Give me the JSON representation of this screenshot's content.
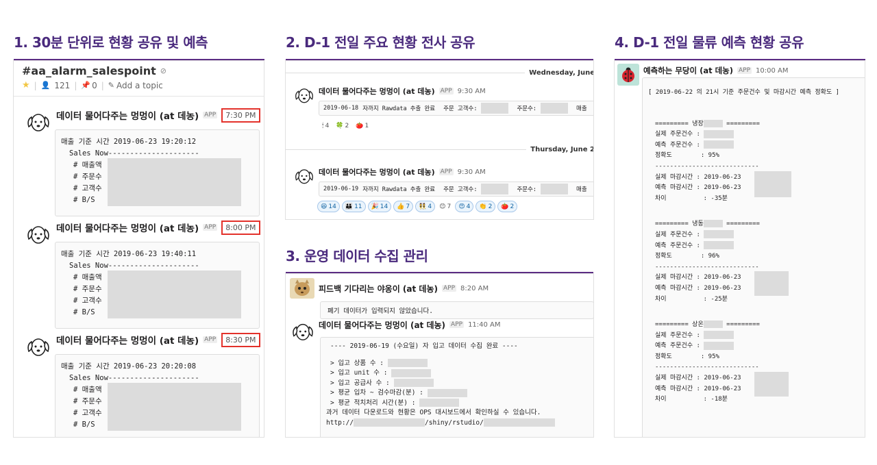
{
  "sections": [
    {
      "title": "1. 30분 단위로 현황 공유 및 예측"
    },
    {
      "title": "2. D-1 전일 주요 현황 전사 공유"
    },
    {
      "title": "3. 운영 데이터 수집 관리"
    },
    {
      "title": "4. D-1 전일 물류 예측 현황 공유"
    }
  ],
  "panel1": {
    "channel": "#aa_alarm_salespoint",
    "members": "121",
    "pins": "0",
    "add_topic": "Add a topic",
    "sender": "데이터 물어다주는 멍멍이 (at 데농)",
    "app": "APP",
    "messages": [
      {
        "time": "7:30 PM",
        "header": "매출 기준 시간 2019-06-23 19:20:12",
        "sales_now": "Sales Now---------------------",
        "rows": [
          "# 매출액",
          "# 주문수",
          "# 고객수",
          "# B/S"
        ]
      },
      {
        "time": "8:00 PM",
        "header": "매출 기준 시간 2019-06-23 19:40:11",
        "sales_now": "Sales Now---------------------",
        "rows": [
          "# 매출액",
          "# 주문수",
          "# 고객수",
          "# B/S"
        ]
      },
      {
        "time": "8:30 PM",
        "header": "매출 기준 시간 2019-06-23 20:20:08",
        "sales_now": "Sales Now---------------------",
        "rows": [
          "# 매출액",
          "# 주문수",
          "# 고객수",
          "# B/S"
        ]
      }
    ]
  },
  "panel2": {
    "date1": "Wednesday, June",
    "date2": "Thursday, June 2",
    "sender": "데이터 물어다주는 멍멍이 (at 데농)",
    "app": "APP",
    "messages": [
      {
        "time": "9:30 AM",
        "date": "2019-06-18",
        "text": "자까지 Rawdata 추출 완료",
        "label1": "주문 고객수:",
        "label2": "주문수:",
        "label3": "매출"
      },
      {
        "time": "9:30 AM",
        "date": "2019-06-19",
        "text": "자까지 Rawdata 추출 완료",
        "label1": "주문 고객수:",
        "label2": "주문수:",
        "label3": "매출"
      }
    ],
    "reactions1": [
      "4",
      "2",
      "1"
    ],
    "reactions2": [
      "14",
      "11",
      "14",
      "7",
      "4",
      "7",
      "4",
      "2",
      "2"
    ]
  },
  "panel3": {
    "sender1": "피드백 기다리는 야옹이 (at 데농)",
    "app": "APP",
    "time1": "8:20 AM",
    "msg1": "폐기 데이터가 입력되지 않았습니다.",
    "sender2": "데이터 물어다주는 멍멍이 (at 데농)",
    "time2": "11:40 AM",
    "head": "---- 2019-06-19 (수요일) 자 입고 데이터 수집 완료 ----",
    "lines": [
      "> 입고 상품 수 :",
      "> 입고 unit 수 :",
      "> 입고 공급사 수 :",
      "> 평균 입차 ~ 검수마감(분) :",
      "> 평균 적치처리 시간(분) :"
    ],
    "footer": "과거 데이터 다운로드와 현황은 OPS 대시보드에서 확인하실 수 있습니다.",
    "url_prefix": "http://",
    "url_mid": "/shiny/rstudio/"
  },
  "panel4": {
    "sender": "예측하는 무당이 (at 데농)",
    "app": "APP",
    "time": "10:00 AM",
    "title": "[ 2019-06-22 의 21시 기준 주문건수 및 마감시간 예측 정확도 ]",
    "blocks": [
      {
        "head": "========= 냉장",
        "tail": "=========",
        "l1": "실제 주문건수  :",
        "l2": "예측 주문건수  :",
        "l3": "정확도",
        "acc": ": 95%",
        "sep": "----------------------------",
        "t1": "실제 마감시간  : 2019-06-23",
        "t2": "예측 마감시간  : 2019-06-23",
        "d": "차이",
        "dv": ": -35분"
      },
      {
        "head": "========= 냉동",
        "tail": "=========",
        "l1": "실제 주문건수  :",
        "l2": "예측 주문건수  :",
        "l3": "정확도",
        "acc": ": 96%",
        "sep": "----------------------------",
        "t1": "실제 마감시간  : 2019-06-23",
        "t2": "예측 마감시간  : 2019-06-23",
        "d": "차이",
        "dv": ": -25분"
      },
      {
        "head": "========= 상온",
        "tail": "=========",
        "l1": "실제 주문건수  :",
        "l2": "예측 주문건수  :",
        "l3": "정확도",
        "acc": ": 95%",
        "sep": "----------------------------",
        "t1": "실제 마감시간  : 2019-06-23",
        "t2": "예측 마감시간  : 2019-06-23",
        "d": "차이",
        "dv": ": -18분"
      }
    ]
  }
}
